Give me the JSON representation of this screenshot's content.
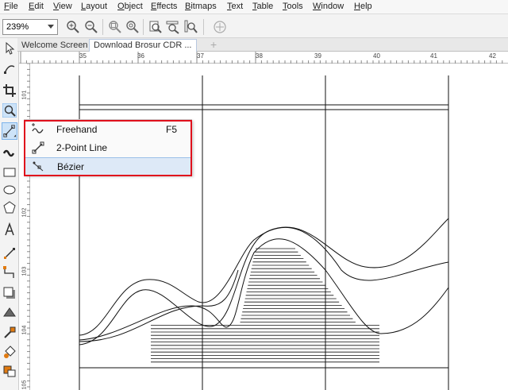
{
  "menu": [
    "File",
    "Edit",
    "View",
    "Layout",
    "Object",
    "Effects",
    "Bitmaps",
    "Text",
    "Table",
    "Tools",
    "Window",
    "Help"
  ],
  "zoom": {
    "value": "239%"
  },
  "tabs": [
    "Welcome Screen",
    "Download Brosur CDR ..."
  ],
  "ruler": {
    "h": [
      "35",
      "36",
      "37",
      "38",
      "39",
      "40",
      "41",
      "42"
    ],
    "v": [
      "101",
      "102",
      "103",
      "104",
      "105"
    ]
  },
  "flyout": [
    {
      "label": "Freehand",
      "shortcut": "F5",
      "icon": "freehand-icon",
      "highlighted": false
    },
    {
      "label": "2-Point Line",
      "shortcut": "",
      "icon": "two-point-line-icon",
      "highlighted": false
    },
    {
      "label": "Bézier",
      "shortcut": "",
      "icon": "bezier-icon",
      "highlighted": true
    }
  ],
  "colors": {
    "accent": "#e0101c",
    "highlight": "#dde9f7"
  }
}
